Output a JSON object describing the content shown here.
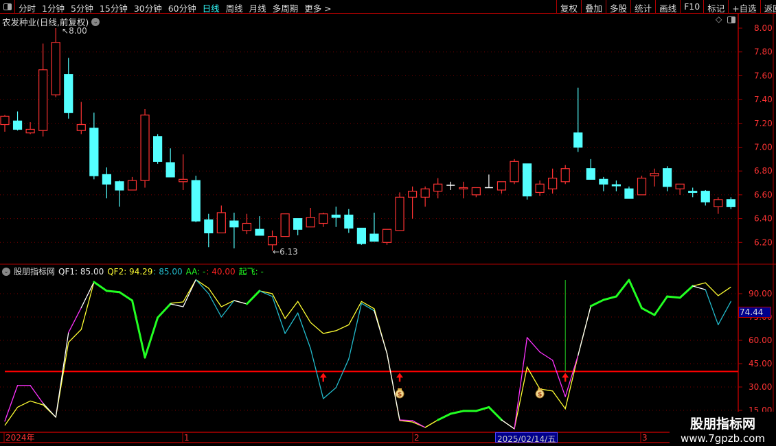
{
  "toolbar": {
    "periods": [
      "分时",
      "1分钟",
      "5分钟",
      "15分钟",
      "30分钟",
      "60分钟",
      "日线",
      "周线",
      "月线",
      "多周期",
      "更多 >"
    ],
    "active_period": "日线",
    "buttons": [
      "复权",
      "叠加",
      "多股",
      "统计",
      "画线",
      "F10",
      "标记",
      "+自选",
      "返回"
    ]
  },
  "chart_title": "农发种业(日线,前复权)",
  "price_axis": {
    "ticks": [
      "8.00",
      "7.80",
      "7.60",
      "7.40",
      "7.20",
      "7.00",
      "6.80",
      "6.60",
      "6.40",
      "6.20"
    ],
    "range": [
      6.2,
      8.0
    ]
  },
  "high_marker": "8.00",
  "low_marker": "6.13",
  "indicator": {
    "name": "股朋指标网",
    "qf1_label": "QF1: 85.00",
    "qf2_label": "QF2: 94.29",
    "cyan_label": ": 85.00",
    "aa_label": "AA: -",
    "aa_value": ": 40.00",
    "qifei_label": "起飞: -",
    "ticks": [
      "90.00",
      "75.00",
      "60.00",
      "45.00",
      "30.00",
      "15.00"
    ],
    "current_value": "74.44",
    "threshold": 40
  },
  "time_axis": {
    "labels": [
      "2024年",
      "1",
      "2",
      "3"
    ],
    "selected_date": "2025/02/14/五"
  },
  "watermark": {
    "title": "股朋指标网",
    "url": "www.7gpzb.com"
  },
  "colors": {
    "up": "#ff3333",
    "down": "#54ffff",
    "M": "#ff33ff",
    "W": "#ffffff",
    "G": "#22ff22",
    "C": "#22bbcc",
    "Y": "#ffff33",
    "qf2": "#ffff33",
    "threshold": "#ff0000"
  },
  "chart_data": {
    "type": "candlestick",
    "candles_ohlc": [
      [
        7.19,
        7.27,
        7.13,
        7.26
      ],
      [
        7.22,
        7.3,
        7.14,
        7.15
      ],
      [
        7.12,
        7.21,
        7.11,
        7.15
      ],
      [
        7.14,
        7.87,
        7.09,
        7.65
      ],
      [
        7.44,
        8.0,
        7.42,
        7.88
      ],
      [
        7.61,
        7.75,
        7.24,
        7.29
      ],
      [
        7.14,
        7.38,
        7.11,
        7.19
      ],
      [
        7.16,
        7.29,
        6.73,
        6.76
      ],
      [
        6.77,
        6.83,
        6.57,
        6.69
      ],
      [
        6.71,
        6.72,
        6.5,
        6.64
      ],
      [
        6.64,
        6.75,
        6.64,
        6.72
      ],
      [
        6.72,
        7.32,
        6.66,
        7.27
      ],
      [
        7.09,
        7.11,
        6.86,
        6.88
      ],
      [
        6.87,
        6.99,
        6.75,
        6.75
      ],
      [
        6.71,
        6.94,
        6.64,
        6.73
      ],
      [
        6.72,
        6.76,
        6.37,
        6.38
      ],
      [
        6.39,
        6.44,
        6.16,
        6.28
      ],
      [
        6.28,
        6.51,
        6.28,
        6.45
      ],
      [
        6.38,
        6.45,
        6.15,
        6.33
      ],
      [
        6.3,
        6.44,
        6.27,
        6.36
      ],
      [
        6.31,
        6.42,
        6.26,
        6.26
      ],
      [
        6.18,
        6.3,
        6.13,
        6.25
      ],
      [
        6.25,
        6.44,
        6.25,
        6.44
      ],
      [
        6.4,
        6.4,
        6.26,
        6.31
      ],
      [
        6.33,
        6.49,
        6.33,
        6.41
      ],
      [
        6.36,
        6.45,
        6.33,
        6.44
      ],
      [
        6.43,
        6.5,
        6.33,
        6.41
      ],
      [
        6.43,
        6.48,
        6.28,
        6.32
      ],
      [
        6.32,
        6.32,
        6.18,
        6.19
      ],
      [
        6.27,
        6.45,
        6.21,
        6.21
      ],
      [
        6.2,
        6.31,
        6.18,
        6.31
      ],
      [
        6.3,
        6.62,
        6.3,
        6.58
      ],
      [
        6.58,
        6.67,
        6.4,
        6.63
      ],
      [
        6.58,
        6.67,
        6.5,
        6.65
      ],
      [
        6.63,
        6.74,
        6.57,
        6.69
      ],
      [
        6.68,
        6.71,
        6.64,
        6.68
      ],
      [
        6.65,
        6.71,
        6.57,
        6.66
      ],
      [
        6.6,
        6.66,
        6.58,
        6.66
      ],
      [
        6.66,
        6.77,
        6.66,
        6.66
      ],
      [
        6.64,
        6.71,
        6.61,
        6.71
      ],
      [
        6.71,
        6.9,
        6.69,
        6.88
      ],
      [
        6.86,
        6.86,
        6.56,
        6.59
      ],
      [
        6.62,
        6.72,
        6.59,
        6.69
      ],
      [
        6.65,
        6.82,
        6.61,
        6.74
      ],
      [
        6.71,
        6.85,
        6.69,
        6.82
      ],
      [
        7.12,
        7.5,
        6.96,
        7.0
      ],
      [
        6.82,
        6.9,
        6.73,
        6.73
      ],
      [
        6.73,
        6.75,
        6.63,
        6.69
      ],
      [
        6.685,
        6.72,
        6.63,
        6.675
      ],
      [
        6.65,
        6.67,
        6.57,
        6.57
      ],
      [
        6.6,
        6.76,
        6.6,
        6.74
      ],
      [
        6.76,
        6.82,
        6.67,
        6.78
      ],
      [
        6.82,
        6.84,
        6.63,
        6.67
      ],
      [
        6.65,
        6.69,
        6.6,
        6.69
      ],
      [
        6.63,
        6.66,
        6.58,
        6.62
      ],
      [
        6.63,
        6.64,
        6.51,
        6.54
      ],
      [
        6.5,
        6.58,
        6.44,
        6.56
      ],
      [
        6.56,
        6.58,
        6.48,
        6.5
      ]
    ],
    "qf1": [
      8,
      31,
      31,
      19.5,
      10.6,
      65,
      81,
      97.5,
      91.8,
      91,
      85.6,
      49,
      74.6,
      83.4,
      81.6,
      99,
      90,
      75,
      85.6,
      83.4,
      91.8,
      88.2,
      64.4,
      77.6,
      54.7,
      22.5,
      29.6,
      48,
      83.8,
      79,
      51.6,
      8.8,
      8.4,
      4,
      8.8,
      12.8,
      14.6,
      14.6,
      17,
      8.8,
      3.1,
      61.8,
      52.5,
      47.2,
      23.8,
      50.3,
      82,
      86,
      88.2,
      98.8,
      80.7,
      76.3,
      88.2,
      87.4,
      94.9,
      92.6,
      70,
      85
    ],
    "qf2": [
      5.3,
      17,
      21,
      18.5,
      10.6,
      58.7,
      67,
      97.5,
      91.8,
      91,
      85.6,
      49,
      74.6,
      83.8,
      84.7,
      99,
      93.5,
      81.6,
      85.6,
      83.4,
      91.8,
      90,
      74,
      85,
      71.5,
      64.4,
      66.2,
      70,
      85,
      80.3,
      51.6,
      8.4,
      7.5,
      4,
      8.8,
      12.8,
      14.6,
      14.6,
      17,
      8.8,
      3.1,
      42.8,
      28.7,
      27.4,
      16,
      50.3,
      82,
      86,
      88.2,
      98.8,
      80.7,
      76.3,
      88.2,
      87.4,
      94.9,
      97,
      88.7,
      94.29
    ],
    "qf1_segment_colors": "MMMWWMWGGGGGGWWCCCWGCCCCCCCCCWWMMYGGGGGWMMMMMWGGGGGGGGWCC",
    "buy_arrows": [
      25,
      31,
      44
    ],
    "money_bags": [
      31,
      42
    ],
    "signal_line_at": 44,
    "indicator_range": [
      15,
      90
    ],
    "time_label_index": [
      0,
      14,
      32,
      50
    ],
    "selected_index": 41
  }
}
